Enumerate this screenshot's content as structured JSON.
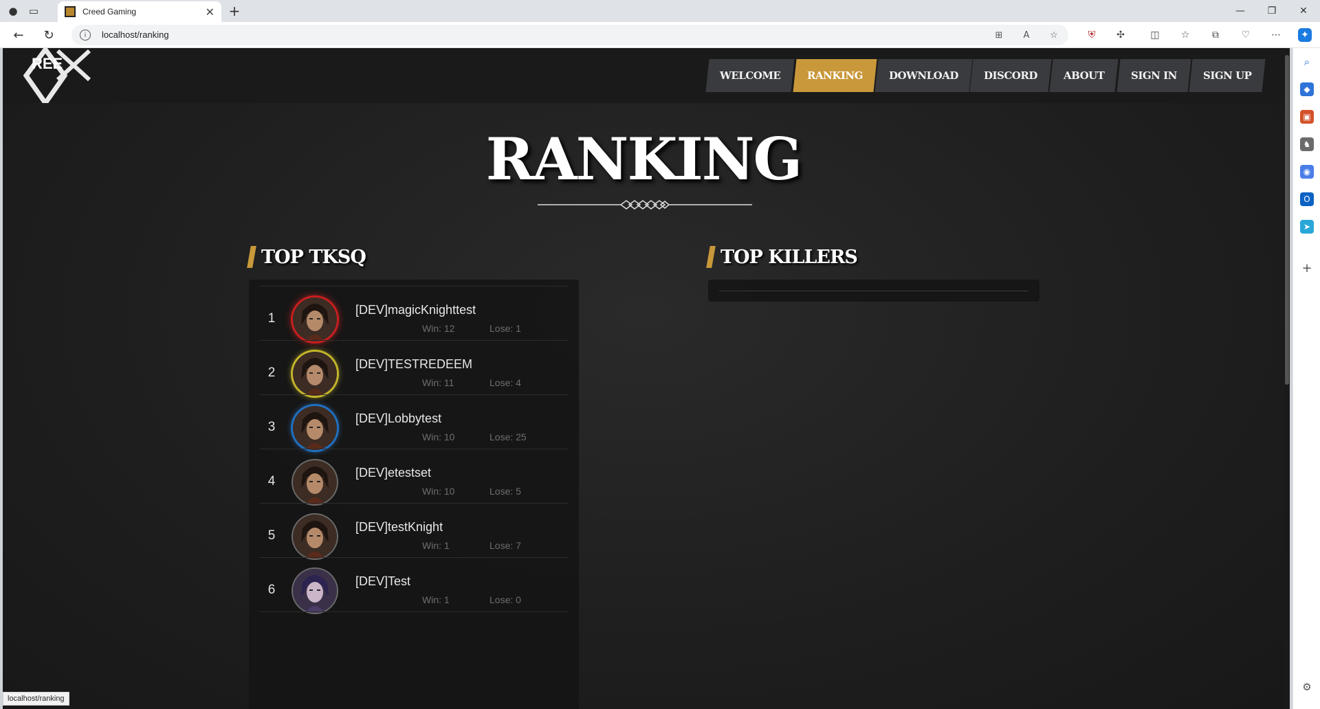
{
  "browser": {
    "tab_title": "Creed Gaming",
    "url": "localhost/ranking",
    "status_url": "localhost/ranking"
  },
  "site": {
    "logo_text": "REE",
    "menu": [
      {
        "label": "WELCOME",
        "active": false
      },
      {
        "label": "RANKING",
        "active": true
      },
      {
        "label": "DOWNLOAD",
        "active": false
      },
      {
        "label": "DISCORD",
        "active": false
      },
      {
        "label": "ABOUT",
        "active": false
      },
      {
        "label": "SIGN IN",
        "active": false
      },
      {
        "label": "SIGN UP",
        "active": false
      }
    ],
    "accent": "#c8983a"
  },
  "page": {
    "title": "RANKING",
    "sections": {
      "top_tksq": "TOP TKSQ",
      "top_killers": "TOP KILLERS"
    }
  },
  "ranking": [
    {
      "rank": "1",
      "name": "[DEV]magicKnighttest",
      "win": "Win: 12",
      "lose": "Lose: 1",
      "frame": "red"
    },
    {
      "rank": "2",
      "name": "[DEV]TESTREDEEM",
      "win": "Win: 11",
      "lose": "Lose: 4",
      "frame": "gold"
    },
    {
      "rank": "3",
      "name": "[DEV]Lobbytest",
      "win": "Win: 10",
      "lose": "Lose: 25",
      "frame": "blue"
    },
    {
      "rank": "4",
      "name": "[DEV]etestset",
      "win": "Win: 10",
      "lose": "Lose: 5",
      "frame": "plain"
    },
    {
      "rank": "5",
      "name": "[DEV]testKnight",
      "win": "Win: 1",
      "lose": "Lose: 7",
      "frame": "plain"
    },
    {
      "rank": "6",
      "name": "[DEV]Test",
      "win": "Win: 1",
      "lose": "Lose: 0",
      "frame": "plain"
    }
  ]
}
